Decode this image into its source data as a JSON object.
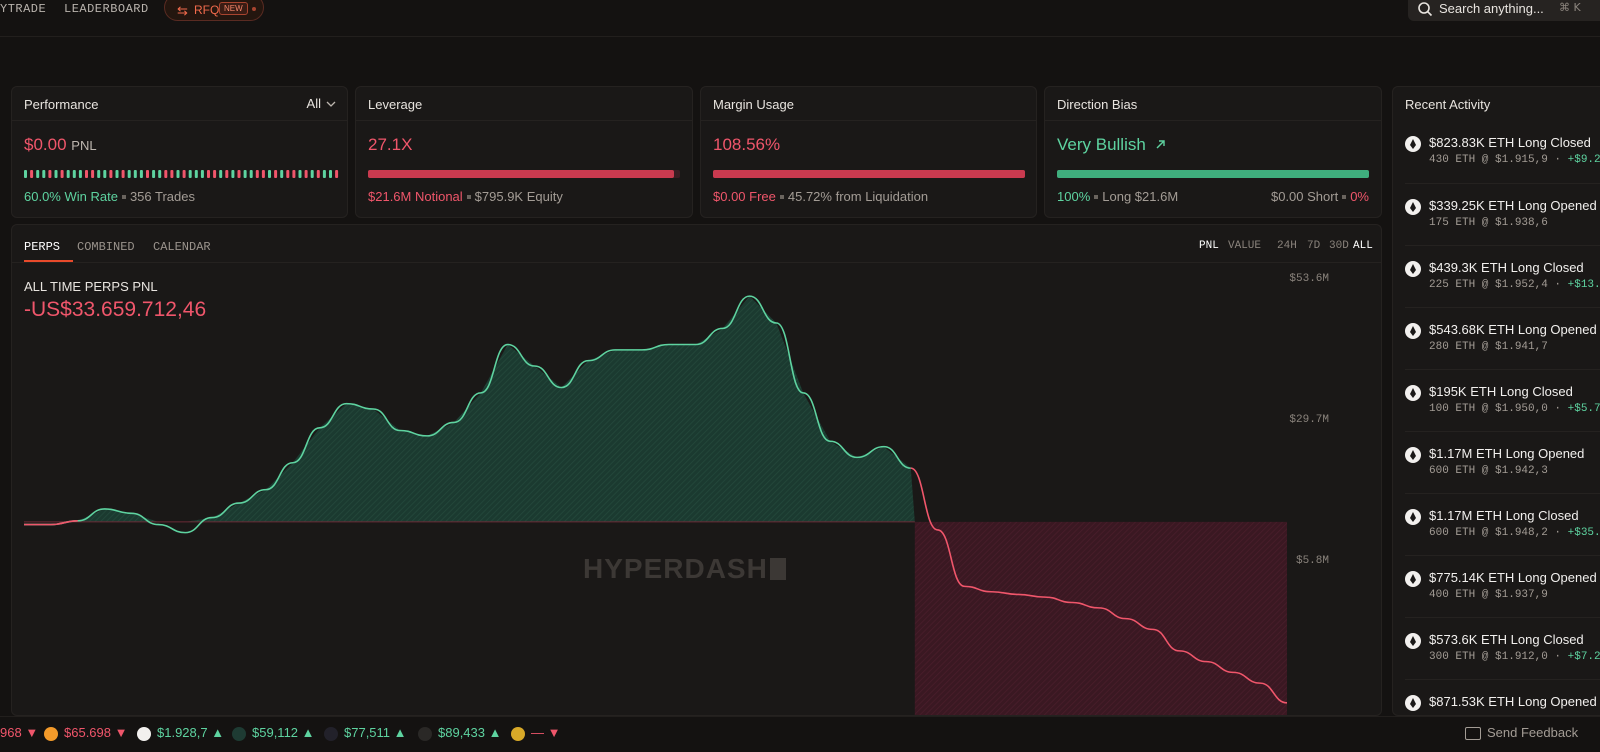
{
  "nav": {
    "items": [
      "YTRADE",
      "LEADERBOARD"
    ],
    "rfq_label": "RFQ",
    "rfq_badge": "NEW",
    "search_placeholder": "Search anything...",
    "search_shortcut": "⌘ K"
  },
  "cards": {
    "performance": {
      "title": "Performance",
      "filter": "All",
      "value": "$0.00",
      "value_suffix": "PNL",
      "win_rate": "60.0% Win Rate",
      "trades": "356 Trades"
    },
    "leverage": {
      "title": "Leverage",
      "value": "27.1X",
      "notional": "$21.6M Notional",
      "equity": "$795.9K Equity",
      "bar_fill": 0.98
    },
    "margin": {
      "title": "Margin Usage",
      "value": "108.56%",
      "free": "$0.00 Free",
      "liquidation": "45.72% from Liquidation",
      "bar_fill": 1.0
    },
    "direction": {
      "title": "Direction Bias",
      "value": "Very Bullish",
      "long_pct": "100%",
      "long": "Long $21.6M",
      "short": "$0.00 Short",
      "short_pct": "0%",
      "bar_fill": 1.0
    }
  },
  "chart_panel": {
    "tabs": [
      "PERPS",
      "COMBINED",
      "CALENDAR"
    ],
    "active_tab": "PERPS",
    "mode_tabs": [
      "PNL",
      "VALUE"
    ],
    "range_tabs": [
      "24H",
      "7D",
      "30D",
      "ALL"
    ],
    "pnl_label": "ALL TIME PERPS PNL",
    "pnl_value": "-US$33.659.712,46",
    "watermark": "HYPERDASH"
  },
  "chart_data": {
    "type": "area",
    "title": "",
    "yticks": [
      "$53.6M",
      "$29.7M",
      "$5.8M"
    ],
    "x": [
      0,
      1,
      2,
      3,
      4,
      5,
      6,
      7,
      8,
      9,
      10,
      11,
      12,
      13,
      14,
      15,
      16,
      17,
      18,
      19,
      20,
      21,
      22,
      23,
      24,
      25,
      26,
      27,
      28,
      29,
      30,
      31,
      32,
      33,
      34,
      35,
      36,
      37,
      38,
      39,
      40,
      41,
      42,
      43,
      44,
      45,
      46,
      47
    ],
    "values": [
      -0.5,
      -0.5,
      0.2,
      2.4,
      1.6,
      -0.5,
      -2.0,
      0.8,
      3.5,
      6.0,
      11.0,
      17.5,
      22.0,
      21.0,
      17.0,
      16.0,
      18.5,
      24.0,
      33.0,
      29.0,
      25.0,
      30.0,
      32.0,
      32.0,
      33.0,
      33.0,
      36.0,
      42.0,
      37.0,
      24.0,
      15.0,
      12.0,
      14.0,
      10.0,
      -1.5,
      -12.0,
      -13.0,
      -13.5,
      -14.0,
      -15.0,
      -16.0,
      -18.0,
      -20.0,
      -24.0,
      -26.0,
      -28.0,
      -30.0,
      -33.66
    ],
    "colors": {
      "positive": "#5ed3a0",
      "negative": "#f0566b"
    }
  },
  "activity": {
    "title": "Recent Activity",
    "items": [
      {
        "title": "$823.83K ETH Long Closed",
        "detail": "430 ETH @ $1.915,9 · ",
        "pnl": "+$9.2"
      },
      {
        "title": "$339.25K ETH Long Opened",
        "detail": "175 ETH @ $1.938,6",
        "pnl": ""
      },
      {
        "title": "$439.3K ETH Long Closed",
        "detail": "225 ETH @ $1.952,4 · ",
        "pnl": "+$13."
      },
      {
        "title": "$543.68K ETH Long Opened",
        "detail": "280 ETH @ $1.941,7",
        "pnl": ""
      },
      {
        "title": "$195K ETH Long Closed",
        "detail": "100 ETH @ $1.950,0 · ",
        "pnl": "+$5.7"
      },
      {
        "title": "$1.17M ETH Long Opened",
        "detail": "600 ETH @ $1.942,3",
        "pnl": ""
      },
      {
        "title": "$1.17M ETH Long Closed",
        "detail": "600 ETH @ $1.948,2 · ",
        "pnl": "+$35."
      },
      {
        "title": "$775.14K ETH Long Opened",
        "detail": "400 ETH @ $1.937,9",
        "pnl": ""
      },
      {
        "title": "$573.6K ETH Long Closed",
        "detail": "300 ETH @ $1.912,0 · ",
        "pnl": "+$7.2"
      },
      {
        "title": "$871.53K ETH Long Opened",
        "detail": "",
        "pnl": ""
      }
    ]
  },
  "ticker": {
    "items": [
      {
        "price": "968",
        "dir": "down"
      },
      {
        "price": "$65.698",
        "dir": "down",
        "icon": "bitcoin-icon"
      },
      {
        "price": "$1.928,7",
        "dir": "up",
        "icon": "ethereum-icon"
      },
      {
        "price": "$59,112",
        "dir": "up",
        "icon": "hyperliquid-icon"
      },
      {
        "price": "$77,511",
        "dir": "up",
        "icon": "solana-icon"
      },
      {
        "price": "$89,433",
        "dir": "up",
        "icon": "drop-icon"
      },
      {
        "price": "—",
        "dir": "down",
        "icon": "coin-icon"
      }
    ],
    "feedback": "Send Feedback"
  }
}
